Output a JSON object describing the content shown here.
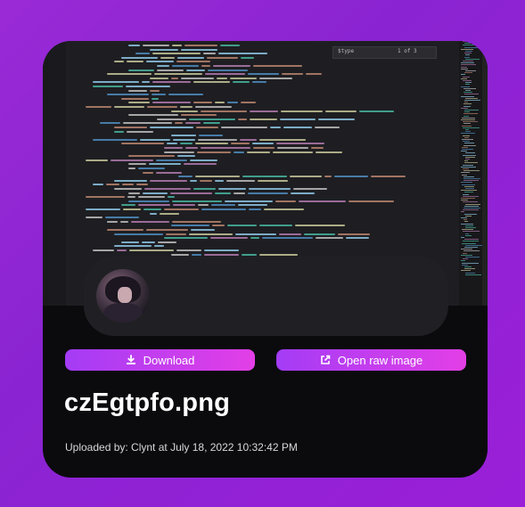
{
  "screenshot_preview": {
    "find_bar": {
      "query": "$type",
      "count": "1 of 3"
    }
  },
  "actions": {
    "download_label": "Download",
    "open_raw_label": "Open raw image"
  },
  "file": {
    "name": "czEgtpfo.png",
    "uploaded_text": "Uploaded by: Clynt at July 18, 2022 10:32:42 PM"
  },
  "icons": {
    "download": "download-icon",
    "open_external": "external-link-icon"
  },
  "colors": {
    "page_bg": "#8f26d4",
    "card_bg": "#0b0b0e",
    "pill_bg": "#202024",
    "button_gradient_start": "#a43cf6",
    "button_gradient_end": "#e33fe6"
  }
}
